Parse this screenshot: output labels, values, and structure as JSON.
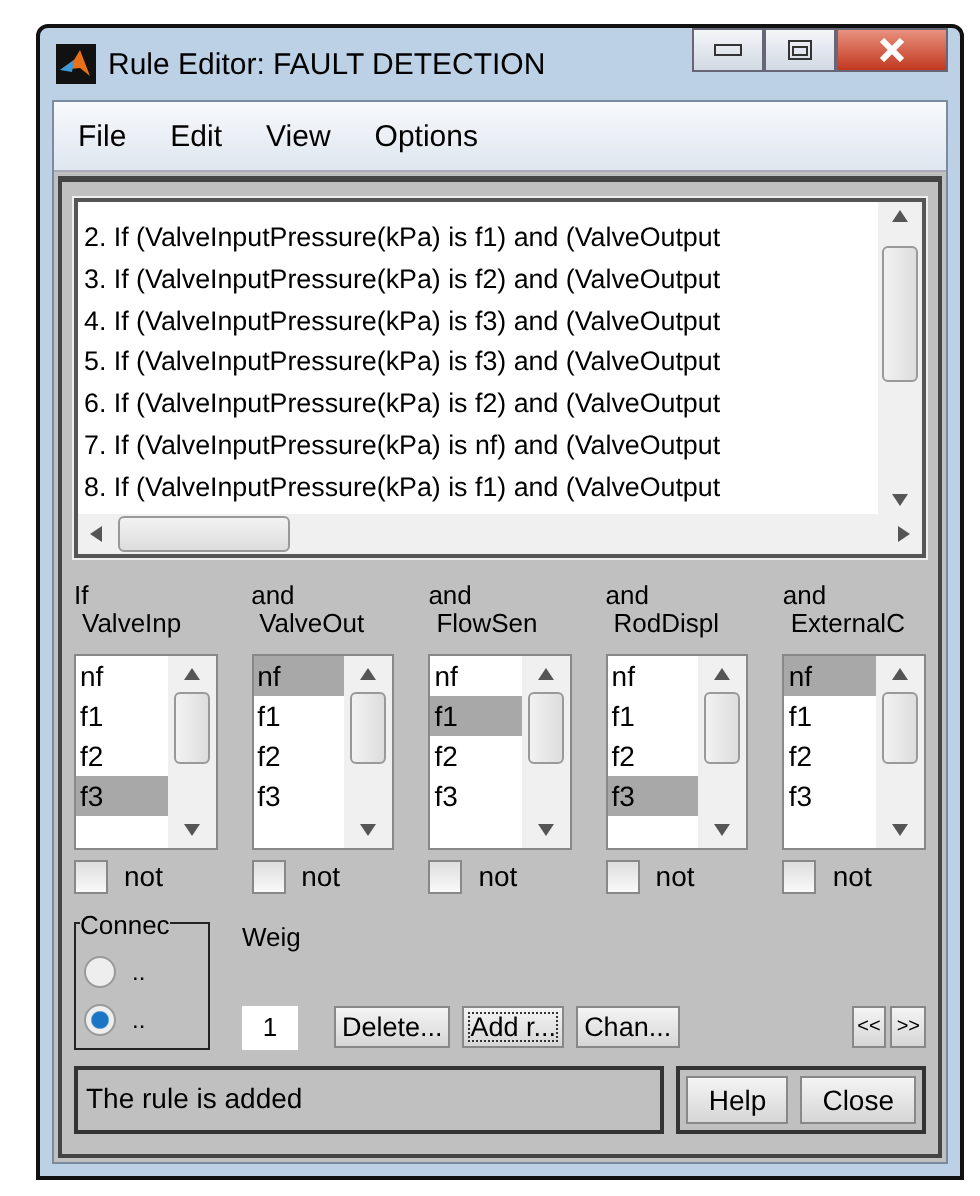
{
  "window": {
    "title": "Rule Editor: FAULT DETECTION"
  },
  "menu": [
    "File",
    "Edit",
    "View",
    "Options"
  ],
  "rules": [
    "2. If (ValveInputPressure(kPa) is f1) and (ValveOutput",
    "3. If (ValveInputPressure(kPa) is f2) and (ValveOutput",
    "4. If (ValveInputPressure(kPa) is f3) and (ValveOutput",
    "5. If (ValveInputPressure(kPa) is f3) and (ValveOutput",
    "6. If (ValveInputPressure(kPa) is f2) and (ValveOutput",
    "7. If (ValveInputPressure(kPa) is nf) and (ValveOutput",
    "8. If (ValveInputPressure(kPa) is f1) and (ValveOutput"
  ],
  "columns": [
    {
      "connective": "If",
      "variable": "ValveInp",
      "not_label": "not",
      "not_checked": false,
      "items": [
        {
          "label": "nf",
          "selected": false
        },
        {
          "label": "f1",
          "selected": false
        },
        {
          "label": "f2",
          "selected": false
        },
        {
          "label": "f3",
          "selected": true
        }
      ]
    },
    {
      "connective": "and",
      "variable": "ValveOut",
      "not_label": "not",
      "not_checked": false,
      "items": [
        {
          "label": "nf",
          "selected": true
        },
        {
          "label": "f1",
          "selected": false
        },
        {
          "label": "f2",
          "selected": false
        },
        {
          "label": "f3",
          "selected": false
        }
      ]
    },
    {
      "connective": "and",
      "variable": "FlowSen",
      "not_label": "not",
      "not_checked": false,
      "items": [
        {
          "label": "nf",
          "selected": false
        },
        {
          "label": "f1",
          "selected": true
        },
        {
          "label": "f2",
          "selected": false
        },
        {
          "label": "f3",
          "selected": false
        }
      ]
    },
    {
      "connective": "and",
      "variable": "RodDispl",
      "not_label": "not",
      "not_checked": false,
      "items": [
        {
          "label": "nf",
          "selected": false
        },
        {
          "label": "f1",
          "selected": false
        },
        {
          "label": "f2",
          "selected": false
        },
        {
          "label": "f3",
          "selected": true
        }
      ]
    },
    {
      "connective": "and",
      "variable": "ExternalC",
      "not_label": "not",
      "not_checked": false,
      "items": [
        {
          "label": "nf",
          "selected": true
        },
        {
          "label": "f1",
          "selected": false
        },
        {
          "label": "f2",
          "selected": false
        },
        {
          "label": "f3",
          "selected": false
        }
      ]
    }
  ],
  "connection": {
    "label": "Connec",
    "options": [
      {
        "label": "..",
        "selected": false
      },
      {
        "label": "..",
        "selected": true
      }
    ]
  },
  "weight": {
    "label": "Weig",
    "value": "1"
  },
  "actions": [
    "Delete...",
    "Add r...",
    "Chan..."
  ],
  "nav": [
    "<<",
    ">>"
  ],
  "status": "The rule is added",
  "buttons": [
    "Help",
    "Close"
  ]
}
